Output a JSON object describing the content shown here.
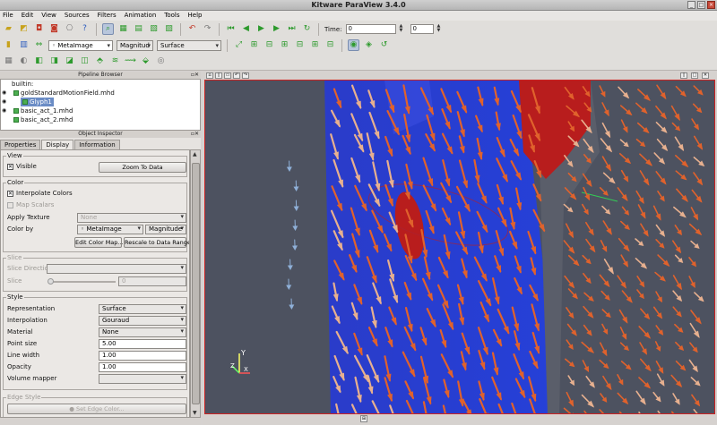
{
  "window": {
    "title": "Kitware ParaView 3.4.0",
    "controls": [
      "_",
      "□",
      "×"
    ]
  },
  "menu": [
    "File",
    "Edit",
    "View",
    "Sources",
    "Filters",
    "Animation",
    "Tools",
    "Help"
  ],
  "toolbar": {
    "time_label": "Time:",
    "time_value": "0",
    "time_index": "0",
    "array_select": "◦ MetaImage",
    "component_select": "Magnitud",
    "representation_select": "Surface"
  },
  "pipeline": {
    "title": "Pipeline Browser",
    "items": [
      {
        "label": "builtin:"
      },
      {
        "label": "goldStandardMotionField.mhd"
      },
      {
        "label": "Glyph1",
        "selected": true
      },
      {
        "label": "basic_act_1.mhd"
      },
      {
        "label": "basic_act_2.mhd"
      }
    ]
  },
  "inspector": {
    "title": "Object Inspector",
    "tabs": [
      "Properties",
      "Display",
      "Information"
    ],
    "active_tab": "Display",
    "view": {
      "legend": "View",
      "visible_label": "Visible",
      "visible_checked": true,
      "zoom_button": "Zoom To Data"
    },
    "color": {
      "legend": "Color",
      "interpolate_label": "Interpolate Colors",
      "interpolate_checked": true,
      "map_scalars_label": "Map Scalars",
      "apply_texture_label": "Apply Texture",
      "apply_texture_value": "None",
      "color_by_label": "Color by",
      "color_by_value": "◦ MetaImage",
      "color_by_component": "Magnitude",
      "edit_color_map": "Edit Color Map...",
      "rescale": "Rescale to Data Range"
    },
    "slice": {
      "legend": "Slice",
      "direction_label": "Slice Direction",
      "slice_label": "Slice",
      "slice_value": "0"
    },
    "style": {
      "legend": "Style",
      "representation_label": "Representation",
      "representation_value": "Surface",
      "interpolation_label": "Interpolation",
      "interpolation_value": "Gouraud",
      "material_label": "Material",
      "material_value": "None",
      "point_size_label": "Point size",
      "point_size_value": "5.00",
      "line_width_label": "Line width",
      "line_width_value": "1.00",
      "opacity_label": "Opacity",
      "opacity_value": "1.00",
      "volume_mapper_label": "Volume mapper"
    },
    "edge": {
      "legend": "Edge Style",
      "button": "Set Edge Color..."
    }
  },
  "viewport": {
    "axes": {
      "x": "X",
      "y": "Y",
      "z": "Z"
    },
    "colors": {
      "background": "#4d5260",
      "plane": "#2a3fd6",
      "red_region": "#b81d1d",
      "arrow": "#e0622c",
      "arrow_light": "#e7b08f",
      "selection_frame": "#cc2222"
    }
  }
}
